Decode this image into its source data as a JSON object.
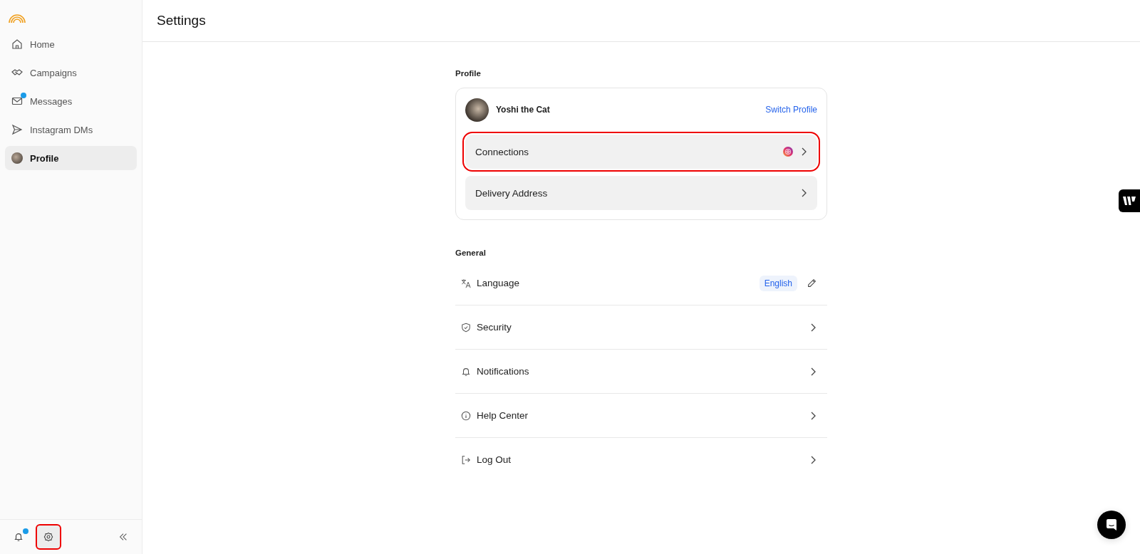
{
  "sidebar": {
    "items": [
      {
        "label": "Home",
        "selected": false,
        "badge": false
      },
      {
        "label": "Campaigns",
        "selected": false,
        "badge": false
      },
      {
        "label": "Messages",
        "selected": false,
        "badge": true
      },
      {
        "label": "Instagram DMs",
        "selected": false,
        "badge": false
      },
      {
        "label": "Profile",
        "selected": true,
        "badge": false
      }
    ],
    "footer": {
      "notifications_badge": true,
      "settings_highlighted": true
    }
  },
  "header": {
    "title": "Settings"
  },
  "profile": {
    "heading": "Profile",
    "name": "Yoshi the Cat",
    "switch_link": "Switch Profile",
    "rows": [
      {
        "label": "Connections",
        "highlighted": true,
        "instagram": true
      },
      {
        "label": "Delivery Address",
        "highlighted": false,
        "instagram": false
      }
    ]
  },
  "general": {
    "heading": "General",
    "rows": [
      {
        "kind": "value",
        "label": "Language",
        "value": "English"
      },
      {
        "kind": "link",
        "label": "Security"
      },
      {
        "kind": "link",
        "label": "Notifications"
      },
      {
        "kind": "link",
        "label": "Help Center"
      },
      {
        "kind": "link",
        "label": "Log Out"
      }
    ]
  }
}
